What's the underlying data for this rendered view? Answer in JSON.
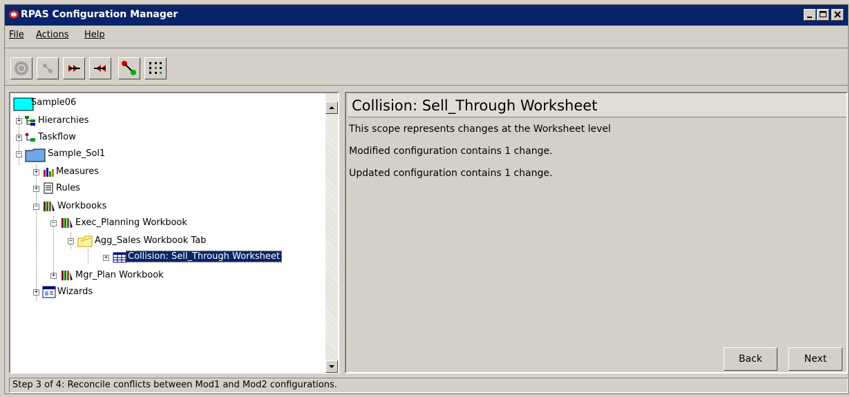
{
  "window": {
    "title": "RPAS Configuration Manager",
    "controls": [
      "minimize",
      "maximize",
      "close"
    ]
  },
  "menu": {
    "items": [
      {
        "label": "File",
        "mnemonic": "F"
      },
      {
        "label": "Actions",
        "mnemonic": "A"
      },
      {
        "label": "Help",
        "mnemonic": "H"
      }
    ]
  },
  "toolbar": {
    "buttons": [
      {
        "icon": "refresh-disabled-icon",
        "enabled": false
      },
      {
        "icon": "connect-disabled-icon",
        "enabled": false
      },
      {
        "icon": "merge-right-icon",
        "enabled": true
      },
      {
        "icon": "merge-left-icon",
        "enabled": true
      },
      {
        "icon": "apply-change-icon",
        "enabled": true
      },
      {
        "icon": "tree-structure-icon",
        "enabled": true
      }
    ]
  },
  "tree": {
    "nodes": [
      {
        "label": "Sample06",
        "icon": "folder-cyan-icon",
        "level": 0,
        "expander": "none"
      },
      {
        "label": "Hierarchies",
        "icon": "hierarchy-icon",
        "level": 0,
        "expander": "+"
      },
      {
        "label": "Taskflow",
        "icon": "taskflow-icon",
        "level": 0,
        "expander": "+"
      },
      {
        "label": "Sample_Sol1",
        "icon": "folder-blue-icon",
        "level": 0,
        "expander": "-"
      },
      {
        "label": "Measures",
        "icon": "measures-icon",
        "level": 1,
        "expander": "+"
      },
      {
        "label": "Rules",
        "icon": "rules-icon",
        "level": 1,
        "expander": "+"
      },
      {
        "label": "Workbooks",
        "icon": "workbooks-icon",
        "level": 1,
        "expander": "-"
      },
      {
        "label": "Exec_Planning Workbook",
        "icon": "workbooks-icon",
        "level": 2,
        "expander": "-"
      },
      {
        "label": "Agg_Sales Workbook Tab",
        "icon": "workbook-tab-icon",
        "level": 3,
        "expander": "-"
      },
      {
        "label": "Collision: Sell_Through Worksheet",
        "icon": "worksheet-icon",
        "level": 4,
        "expander": "+",
        "selected": true
      },
      {
        "label": "Mgr_Plan Workbook",
        "icon": "workbooks-icon",
        "level": 2,
        "expander": "+"
      },
      {
        "label": "Wizards",
        "icon": "wizards-icon",
        "level": 1,
        "expander": "+"
      }
    ]
  },
  "details": {
    "title": "Collision: Sell_Through Worksheet",
    "lines": [
      "This scope represents changes at the Worksheet level",
      "Modified configuration contains 1 change.",
      "Updated configuration contains 1 change."
    ],
    "back_label": "Back",
    "next_label": "Next"
  },
  "status": {
    "text": "Step 3 of 4: Reconcile conflicts between Mod1 and Mod2 configurations."
  },
  "colors": {
    "titlebar": "#0a246a",
    "selection": "#0a246a",
    "face": "#d4d0c8"
  }
}
